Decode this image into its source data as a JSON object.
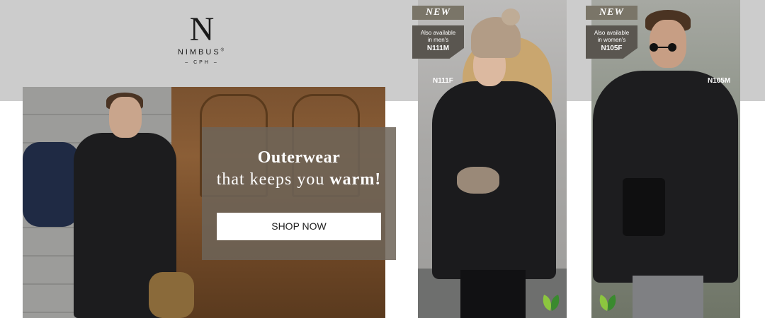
{
  "brand": {
    "logo_letter": "N",
    "wordmark": "NIMBUS",
    "registered": "®",
    "subline": "– CPH –"
  },
  "promo": {
    "heading": "Outerwear",
    "tagline_plain": "that keeps you",
    "tagline_bold": "warm!",
    "cta_label": "SHOP NOW"
  },
  "products": [
    {
      "badge": "NEW",
      "availability_line1": "Also available",
      "availability_line2": "in men's",
      "alt_code": "N111M",
      "style_code": "N111F",
      "eco_icon": "leaf-icon"
    },
    {
      "badge": "NEW",
      "availability_line1": "Also available",
      "availability_line2": "in women's",
      "alt_code": "N105F",
      "style_code": "N105M",
      "eco_icon": "leaf-icon"
    }
  ],
  "colors": {
    "top_band": "#cccccc",
    "badge": "#7a7568",
    "availability_tag": "#5a5650",
    "promo_overlay": "#6e6458",
    "leaf_light": "#8cc63f",
    "leaf_dark": "#3a8a2e"
  }
}
